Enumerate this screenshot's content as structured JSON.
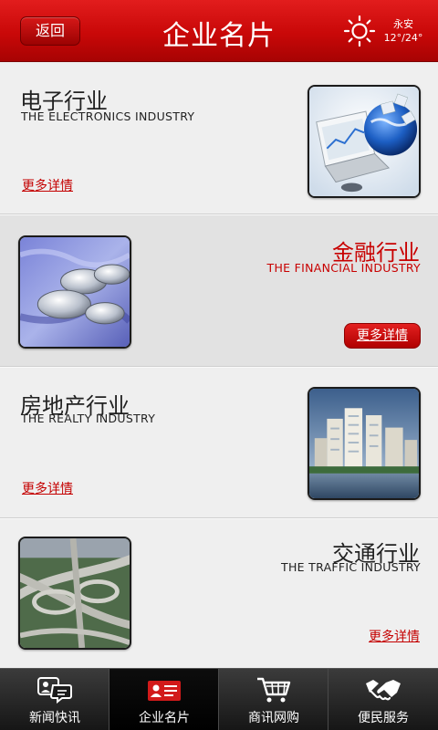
{
  "header": {
    "back_label": "返回",
    "title": "企业名片",
    "weather": {
      "city": "永安",
      "temp": "12°/24°",
      "icon": "sun-icon"
    }
  },
  "industries": [
    {
      "title_cn": "电子行业",
      "title_en": "THE ELECTRONICS INDUSTRY",
      "more_label": "更多详情",
      "image": "electronics-photo",
      "highlighted": false
    },
    {
      "title_cn": "金融行业",
      "title_en": "THE FINANCIAL INDUSTRY",
      "more_label": "更多详情",
      "image": "coins-photo",
      "highlighted": true
    },
    {
      "title_cn": "房地产行业",
      "title_en": "THE REALTY INDUSTRY",
      "more_label": "更多详情",
      "image": "buildings-photo",
      "highlighted": false
    },
    {
      "title_cn": "交通行业",
      "title_en": "THE TRAFFIC INDUSTRY",
      "more_label": "更多详情",
      "image": "highway-photo",
      "highlighted": false
    }
  ],
  "tabbar": {
    "tabs": [
      {
        "label": "新闻快讯",
        "icon": "news-chat-icon",
        "active": false
      },
      {
        "label": "企业名片",
        "icon": "business-card-icon",
        "active": true
      },
      {
        "label": "商讯网购",
        "icon": "shopping-cart-icon",
        "active": false
      },
      {
        "label": "便民服务",
        "icon": "handshake-icon",
        "active": false
      }
    ]
  },
  "colors": {
    "brand_red": "#c90808",
    "link_red": "#c40000",
    "tabbar_bg": "#1f1f1f"
  }
}
